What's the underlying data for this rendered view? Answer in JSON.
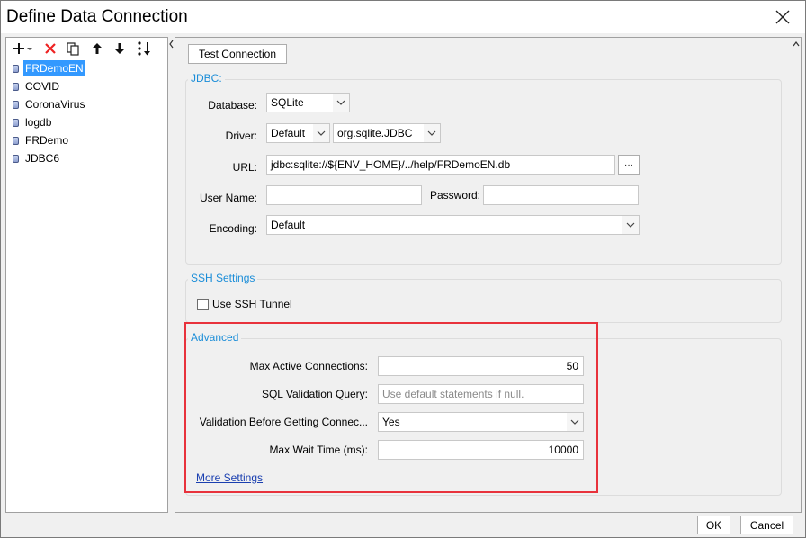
{
  "window": {
    "title": "Define Data Connection"
  },
  "connections": [
    {
      "label": "FRDemoEN",
      "selected": true
    },
    {
      "label": "COVID"
    },
    {
      "label": "CoronaVirus"
    },
    {
      "label": "logdb"
    },
    {
      "label": "FRDemo"
    },
    {
      "label": "JDBC6"
    }
  ],
  "test_connection_label": "Test Connection",
  "jdbc": {
    "title": "JDBC:",
    "database_label": "Database:",
    "database_value": "SQLite",
    "driver_label": "Driver:",
    "driver_mode": "Default",
    "driver_value": "org.sqlite.JDBC",
    "url_label": "URL:",
    "url_value": "jdbc:sqlite://${ENV_HOME}/../help/FRDemoEN.db",
    "url_browse": "···",
    "username_label": "User Name:",
    "username_value": "",
    "password_label": "Password:",
    "password_value": "",
    "encoding_label": "Encoding:",
    "encoding_value": "Default"
  },
  "ssh": {
    "title": "SSH Settings",
    "use_tunnel_label": "Use SSH Tunnel",
    "use_tunnel_checked": false
  },
  "advanced": {
    "title": "Advanced",
    "max_active_label": "Max Active Connections:",
    "max_active_value": "50",
    "sql_validation_label": "SQL Validation Query:",
    "sql_validation_placeholder": "Use default statements if null.",
    "validation_before_label": "Validation Before Getting Connec...",
    "validation_before_value": "Yes",
    "max_wait_label": "Max Wait Time (ms):",
    "max_wait_value": "10000",
    "more_settings_label": "More Settings"
  },
  "footer": {
    "ok_label": "OK",
    "cancel_label": "Cancel"
  },
  "colors": {
    "accent": "#1a8dd8",
    "selection": "#3399ff",
    "highlight_border": "#e8323c",
    "link": "#1a3fb0"
  },
  "icons": [
    "close-icon",
    "add-icon",
    "dropdown-caret-icon",
    "delete-icon",
    "copy-icon",
    "move-up-icon",
    "move-down-icon",
    "sort-icon",
    "database-icon",
    "chevron-down-icon",
    "ellipsis-icon"
  ]
}
